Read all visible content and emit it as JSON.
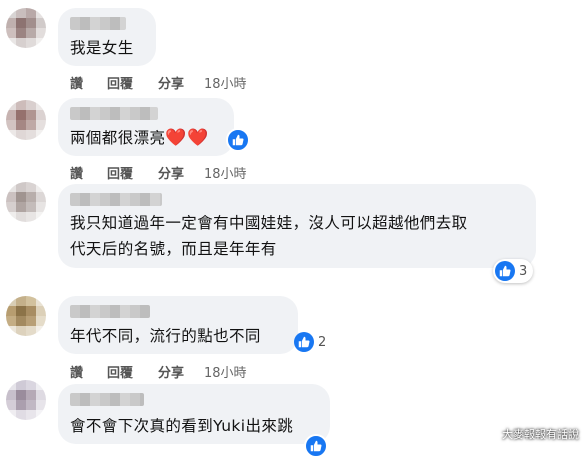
{
  "comments": [
    {
      "text": "我是女生",
      "actions": {
        "like": "讚",
        "reply": "回覆",
        "share": "分享",
        "time": "18小時"
      }
    },
    {
      "text": "兩個都很漂亮",
      "hearts": "❤️❤️",
      "actions": {
        "like": "讚",
        "reply": "回覆",
        "share": "分享",
        "time": "18小時"
      }
    },
    {
      "text_line1": "我只知道過年一定會有中國娃娃，沒人可以超越他們去取",
      "text_line2": "代天后的名號，而且是年年有",
      "reaction_count": "3"
    },
    {
      "text": "年代不同，流行的點也不同",
      "reaction_count": "2",
      "actions": {
        "like": "讚",
        "reply": "回覆",
        "share": "分享",
        "time": "18小時"
      }
    },
    {
      "text": "會不會下次真的看到Yuki出來跳"
    }
  ],
  "watermark": "大麥報報有話說",
  "colors": {
    "bubble": "#f0f2f5",
    "like_blue": "#1877f2",
    "heart_red": "#e02424"
  },
  "icons": {
    "like": "thumbs-up-icon",
    "heart": "heart-icon"
  }
}
